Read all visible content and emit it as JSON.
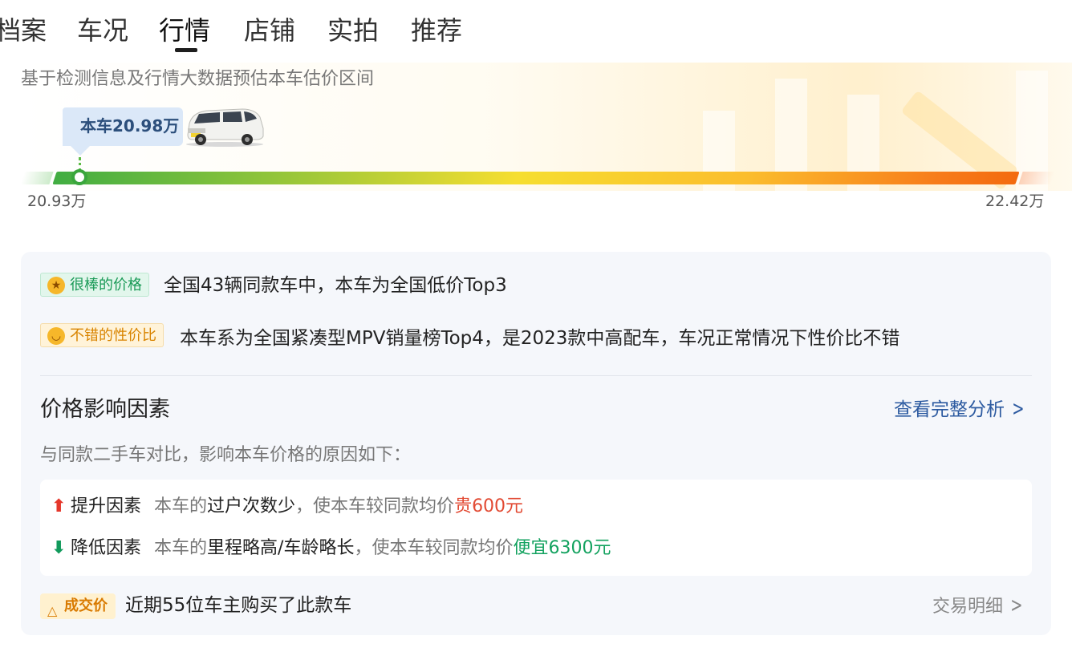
{
  "tabs": [
    {
      "label": "档案"
    },
    {
      "label": "车况"
    },
    {
      "label": "行情",
      "active": true
    },
    {
      "label": "店铺"
    },
    {
      "label": "实拍"
    },
    {
      "label": "推荐"
    }
  ],
  "estimate": {
    "subtitle": "基于检测信息及行情大数据预估本车估价区间",
    "this_car_price": "本车20.98万",
    "range_min": "20.93万",
    "range_max": "22.42万",
    "marker_value": 20.98,
    "min_value": 20.93,
    "max_value": 22.42
  },
  "highlights": [
    {
      "tag": "很棒的价格",
      "emoji": "star-eyes-emoji",
      "text": "全国43辆同款车中，本车为全国低价Top3"
    },
    {
      "tag": "不错的性价比",
      "emoji": "smile-emoji",
      "text": "本车系为全国紧凑型MPV销量榜Top4，是2023款中高配车，车况正常情况下性价比不错"
    }
  ],
  "factors": {
    "title": "价格影响因素",
    "link": "查看完整分析",
    "subtitle": "与同款二手车对比，影响本车价格的原因如下：",
    "up": {
      "label": "提升因素",
      "prefix": "本车的",
      "reason": "过户次数少",
      "middle": "，使本车较同款均价",
      "effect": "贵600元"
    },
    "down": {
      "label": "降低因素",
      "prefix": "本车的",
      "reason": "里程略高/车龄略长",
      "middle": "，使本车较同款均价",
      "effect": "便宜6300元"
    }
  },
  "deal": {
    "tag": "成交价",
    "text": "近期55位车主购买了此款车",
    "link": "交易明细"
  },
  "colors": {
    "accent_blue": "#2c5aa0",
    "up_red": "#e24a33",
    "down_green": "#13a25f",
    "bar_start": "#41ad42",
    "bar_end": "#f36a0e"
  }
}
